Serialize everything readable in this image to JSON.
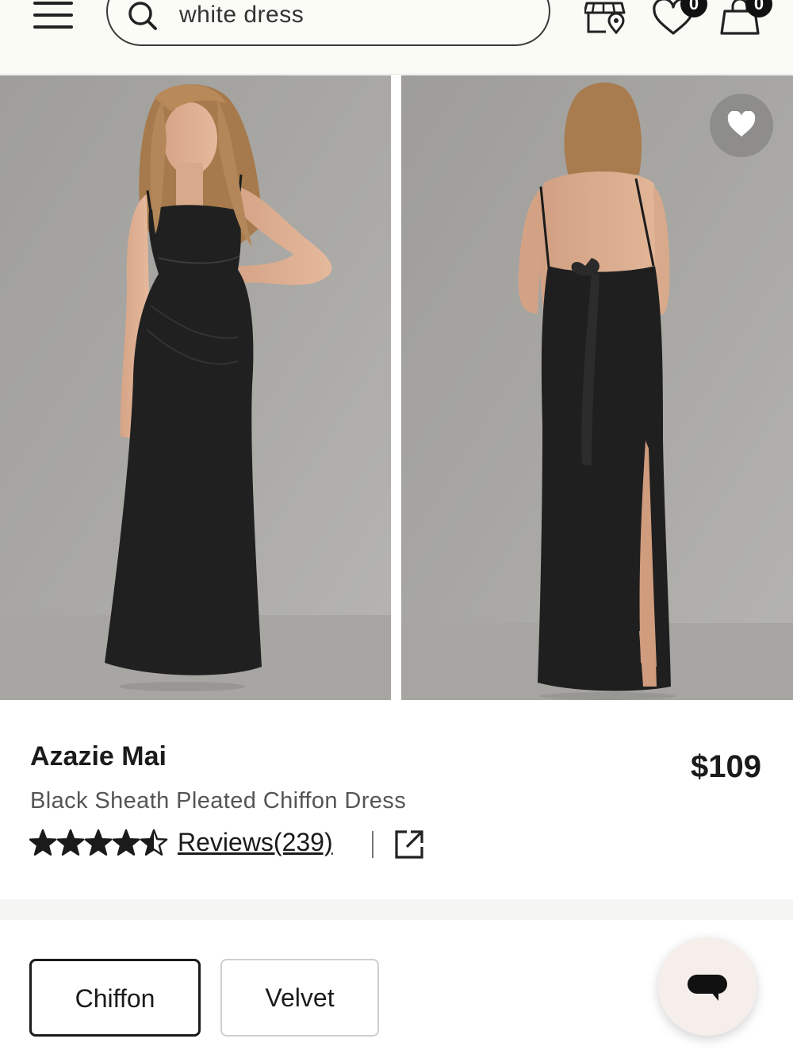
{
  "header": {
    "menu_icon": "hamburger-menu-icon",
    "search": {
      "value": "white dress",
      "icon": "search-icon"
    },
    "store_icon": "store-locator-icon",
    "wishlist": {
      "icon": "heart-icon",
      "count": "0"
    },
    "cart": {
      "icon": "shopping-bag-icon",
      "count": "0"
    }
  },
  "gallery": {
    "images": [
      {
        "description": "Model in black sheath pleated chiffon dress, front view"
      },
      {
        "description": "Model in black sheath pleated chiffon dress, back view with tie"
      }
    ],
    "favorite_icon": "heart-icon"
  },
  "product": {
    "brand": "Azazie Mai",
    "name": "Black Sheath Pleated Chiffon Dress",
    "price": "$109",
    "rating": 4.5,
    "rating_max": 5,
    "reviews_label": "Reviews(239)",
    "share_icon": "external-link-icon"
  },
  "fabric_options": [
    {
      "label": "Chiffon",
      "selected": true
    },
    {
      "label": "Velvet",
      "selected": false
    }
  ],
  "chat": {
    "icon": "chat-bubble-icon"
  },
  "colors": {
    "text": "#1b1b1b",
    "muted": "#555555",
    "header_bg": "#fbfbf6",
    "chat_bg": "#f6eeea"
  }
}
